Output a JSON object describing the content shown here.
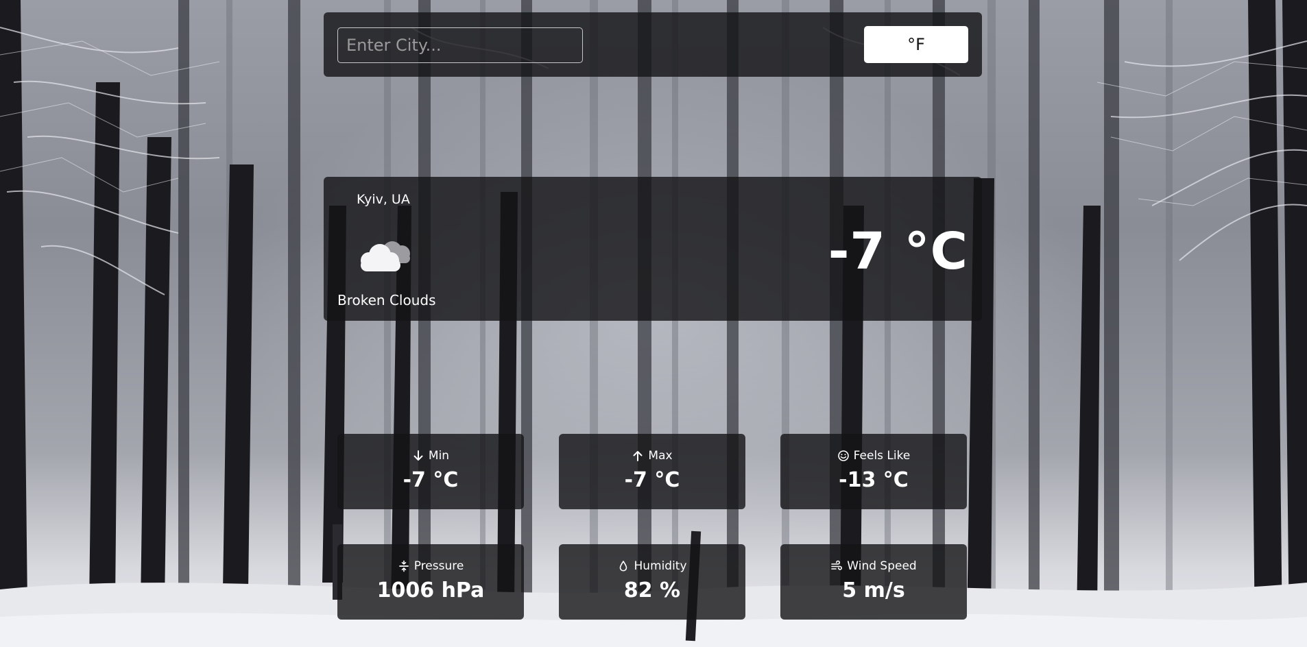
{
  "search": {
    "placeholder": "Enter City...",
    "value": "",
    "unit_button_label": "°F"
  },
  "current": {
    "location": "Kyiv, UA",
    "condition": "Broken Clouds",
    "temperature": "-7 °C",
    "icon": "broken-clouds-icon"
  },
  "stats": [
    {
      "label": "Min",
      "value": "-7 °C",
      "icon": "arrow-down-icon"
    },
    {
      "label": "Max",
      "value": "-7 °C",
      "icon": "arrow-up-icon"
    },
    {
      "label": "Feels Like",
      "value": "-13 °C",
      "icon": "smile-icon"
    },
    {
      "label": "Pressure",
      "value": "1006 hPa",
      "icon": "compress-icon"
    },
    {
      "label": "Humidity",
      "value": "82 %",
      "icon": "droplet-icon"
    },
    {
      "label": "Wind Speed",
      "value": "5 m/s",
      "icon": "wind-icon"
    }
  ],
  "colors": {
    "panel": "#141416",
    "text": "#ffffff",
    "button_bg": "#ffffff",
    "button_text": "#111111"
  }
}
